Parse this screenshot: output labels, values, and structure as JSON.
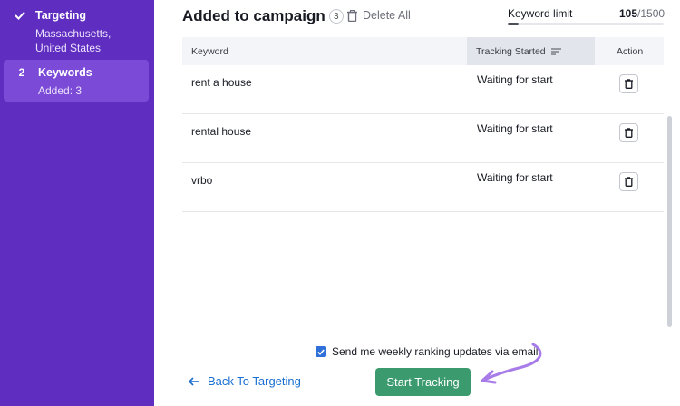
{
  "sidebar": {
    "steps": [
      {
        "marker": "check-icon",
        "title": "Targeting",
        "subtitle": "Massachusetts, United States",
        "state": "done"
      },
      {
        "marker": "2",
        "title": "Keywords",
        "subtitle": "Added: 3",
        "state": "active"
      }
    ]
  },
  "header": {
    "title": "Added to campaign",
    "count": "3",
    "delete_all": "Delete All",
    "keyword_limit": {
      "label": "Keyword limit",
      "used": "105",
      "total": "/1500",
      "fraction": 0.07
    }
  },
  "table": {
    "columns": {
      "keyword": "Keyword",
      "tracking": "Tracking Started",
      "action": "Action"
    },
    "rows": [
      {
        "keyword": "rent a house",
        "status": "Waiting for start"
      },
      {
        "keyword": "rental house",
        "status": "Waiting for start"
      },
      {
        "keyword": "vrbo",
        "status": "Waiting for start"
      }
    ]
  },
  "footer": {
    "email_opt_in": {
      "label": "Send me weekly ranking updates via email",
      "checked": true
    },
    "back_label": "Back To Targeting",
    "start_label": "Start Tracking"
  },
  "colors": {
    "sidebar": "#5f2dbf",
    "sidebar_active": "#7b4ad6",
    "primary_button": "#3b9a6e",
    "link": "#1a6fd1",
    "checkbox": "#2e6fd9",
    "annotation_arrow": "#a77ce8"
  }
}
